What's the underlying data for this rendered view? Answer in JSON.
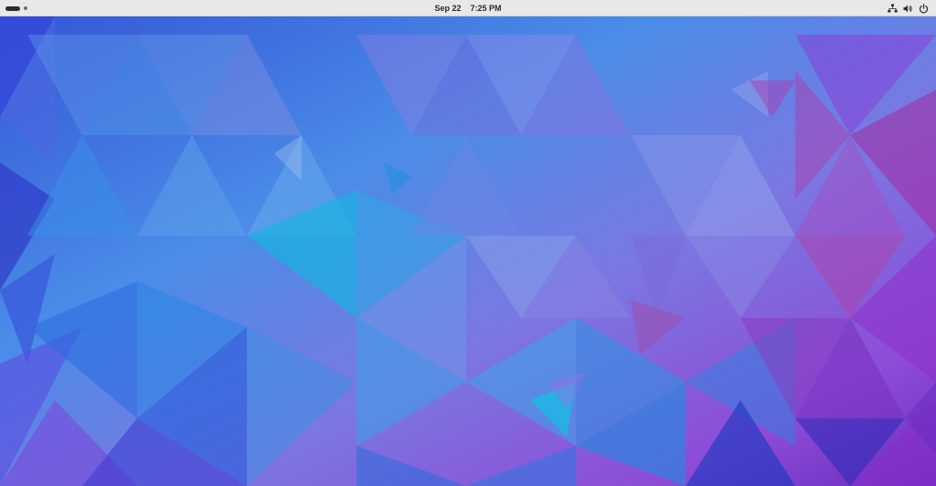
{
  "topbar": {
    "date": "Sep 22",
    "time": "7:25 PM",
    "icons": [
      "network-wired-icon",
      "volume-icon",
      "power-icon"
    ]
  },
  "colors": {
    "topbar_bg": "#e8e8e8",
    "topbar_text": "#2a2a2a",
    "wallpaper_blue": "#3a8be6",
    "wallpaper_purple": "#8a48d8",
    "wallpaper_magenta": "#b03ca8"
  }
}
